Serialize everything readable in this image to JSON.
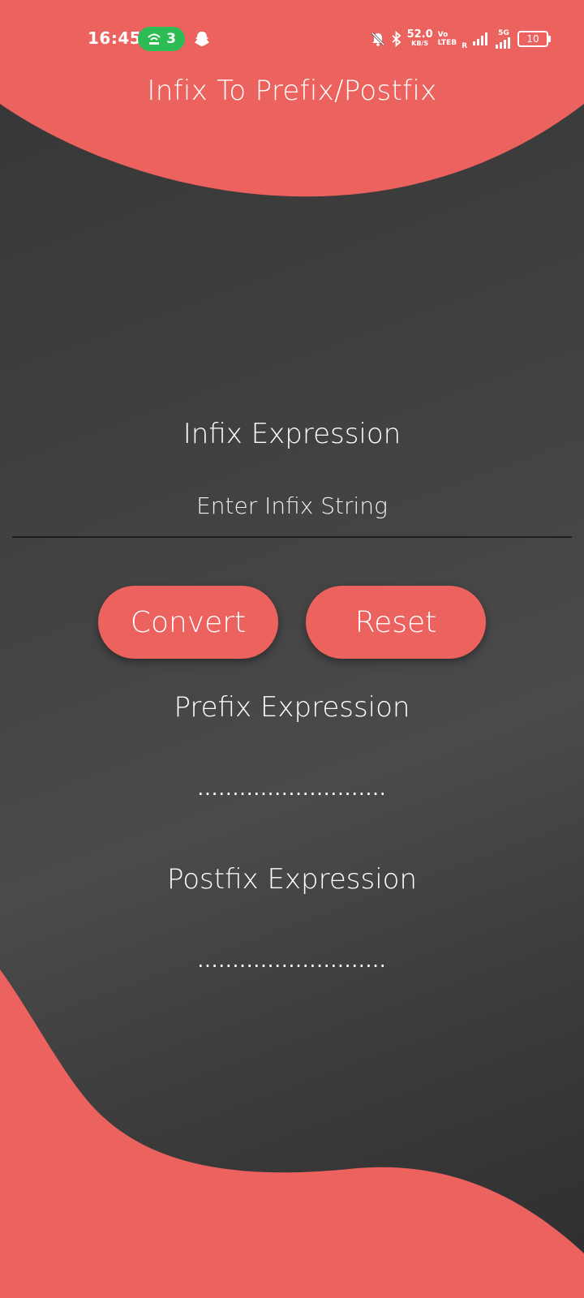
{
  "status_bar": {
    "time": "16:45",
    "hotspot_count": "3",
    "net_speed_value": "52.0",
    "net_speed_unit": "KB/S",
    "volte_top": "Vo",
    "volte_bottom": "LTEB",
    "roaming": "R",
    "network_type": "5G",
    "battery": "10"
  },
  "app": {
    "title": "Infix To Prefix/Postfix"
  },
  "infix": {
    "label": "Infix Expression",
    "placeholder": "Enter Infix String",
    "value": ""
  },
  "buttons": {
    "convert": "Convert",
    "reset": "Reset"
  },
  "prefix": {
    "label": "Prefix Expression",
    "result": "..........................."
  },
  "postfix": {
    "label": "Postfix Expression",
    "result": "..........................."
  },
  "colors": {
    "accent": "#ec625e",
    "background": "#3c3c3c",
    "hotspot": "#2dbb53"
  }
}
